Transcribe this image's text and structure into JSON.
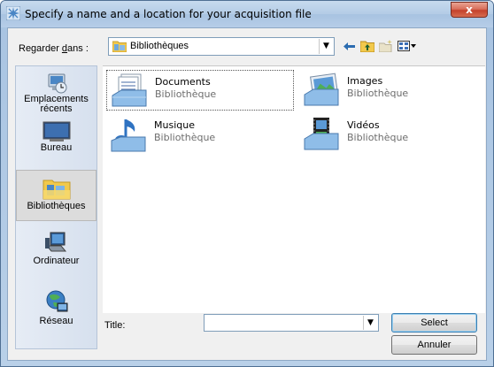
{
  "window": {
    "title": "Specify a name and a location for your acquisition file",
    "close_label": "x"
  },
  "lookin": {
    "label_prefix": "Regarder ",
    "label_underlined": "d",
    "label_suffix": "ans :",
    "value": "Bibliothèques"
  },
  "toolbar": {
    "back_icon": "back-arrow-icon",
    "up_icon": "folder-up-icon",
    "new_folder_icon": "new-folder-icon",
    "view_icon": "view-menu-icon"
  },
  "places": [
    {
      "label": "Emplacements\nrécents",
      "icon": "recent-places-icon"
    },
    {
      "label": "Bureau",
      "icon": "desktop-icon"
    },
    {
      "label": "Bibliothèques",
      "icon": "libraries-icon",
      "active": true
    },
    {
      "label": "Ordinateur",
      "icon": "computer-icon"
    },
    {
      "label": "Réseau",
      "icon": "network-icon"
    }
  ],
  "items": [
    {
      "name": "Documents",
      "type": "Bibliothèque",
      "icon": "documents-library-icon"
    },
    {
      "name": "Images",
      "type": "Bibliothèque",
      "icon": "pictures-library-icon"
    },
    {
      "name": "Musique",
      "type": "Bibliothèque",
      "icon": "music-library-icon"
    },
    {
      "name": "Vidéos",
      "type": "Bibliothèque",
      "icon": "videos-library-icon"
    }
  ],
  "title_field": {
    "label": "Title:",
    "value": ""
  },
  "buttons": {
    "select": "Select",
    "cancel": "Annuler"
  },
  "colors": {
    "title_gradient": "#b3cce6",
    "close_button": "#c4412a",
    "folder_yellow": "#f2c94c",
    "accent_blue": "#3c7fb1"
  }
}
